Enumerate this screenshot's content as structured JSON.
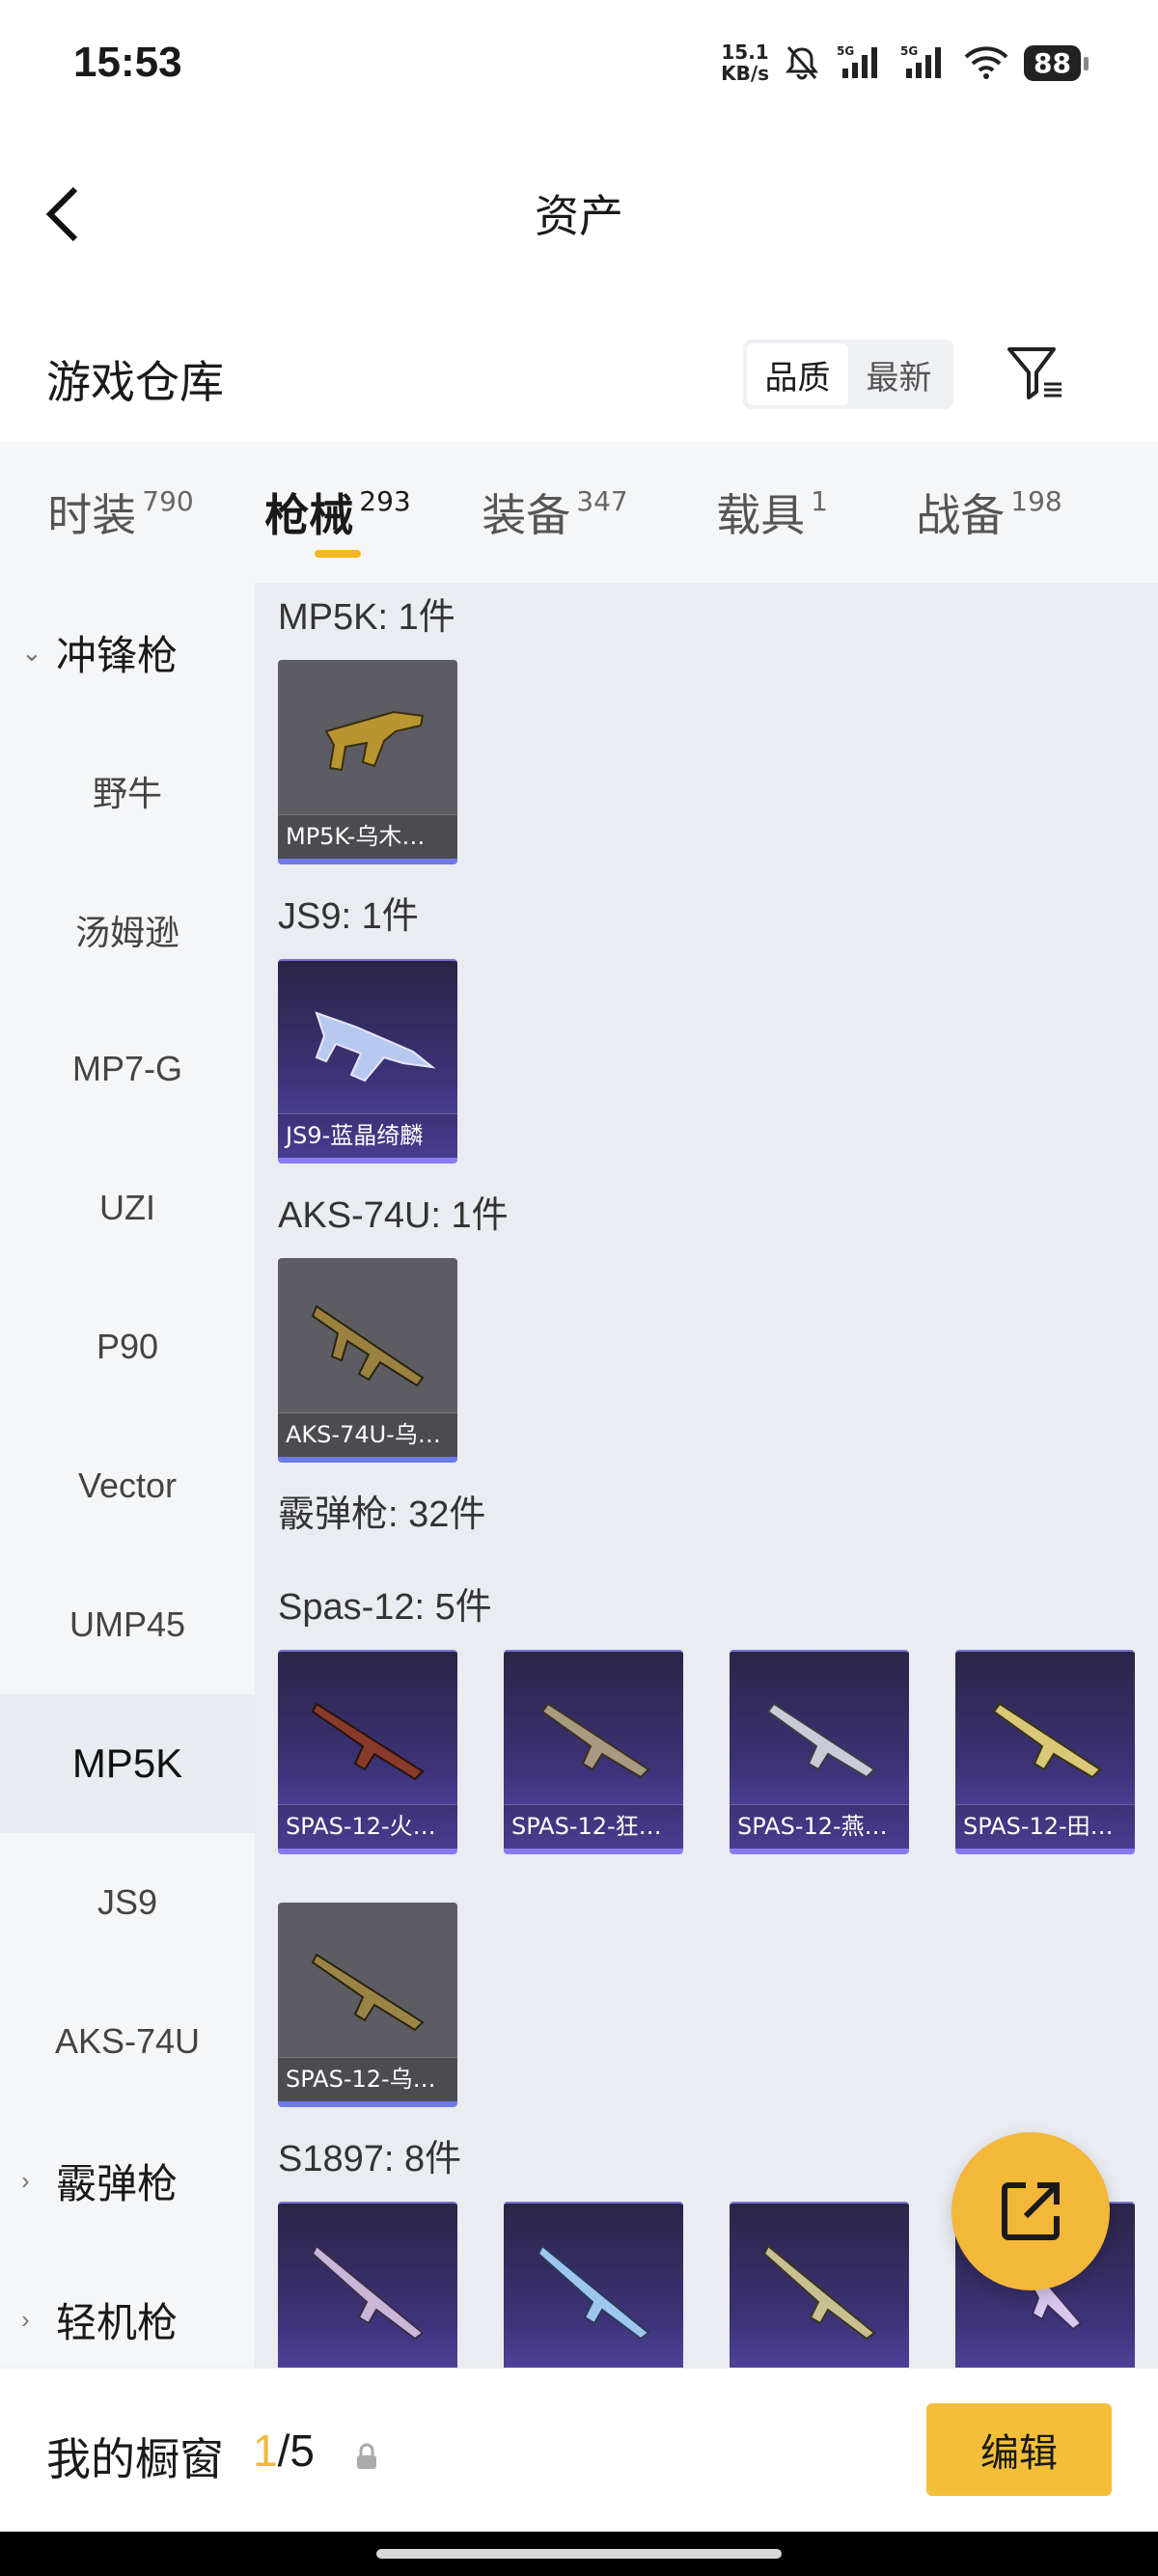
{
  "status": {
    "time": "15:53",
    "net_speed_value": "15.1",
    "net_speed_unit": "KB/s",
    "signal1": "5G",
    "signal2": "5G",
    "battery": "88"
  },
  "header": {
    "title": "资产",
    "back_icon": "chevron-left-icon"
  },
  "warehouse": {
    "title": "游戏仓库",
    "sort": {
      "quality": "品质",
      "latest": "最新",
      "selected": "品质"
    },
    "filter_icon": "filter-icon"
  },
  "tabs": [
    {
      "label": "时装",
      "count": "790"
    },
    {
      "label": "枪械",
      "count": "293",
      "active": true
    },
    {
      "label": "装备",
      "count": "347"
    },
    {
      "label": "载具",
      "count": "1"
    },
    {
      "label": "战备",
      "count": "198"
    }
  ],
  "sidebar": {
    "group_smg": "冲锋枪",
    "items": [
      "野牛",
      "汤姆逊",
      "MP7-G",
      "UZI",
      "P90",
      "Vector",
      "UMP45",
      "MP5K",
      "JS9",
      "AKS-74U"
    ],
    "active": "MP5K",
    "group_shotgun": "霰弹枪",
    "group_lmg": "轻机枪"
  },
  "content": {
    "mp5k_label": "MP5K: 1件",
    "mp5k_card": "MP5K-乌木…",
    "js9_label": "JS9: 1件",
    "js9_card": "JS9-蓝晶绮麟",
    "aks_label": "AKS-74U: 1件",
    "aks_card": "AKS-74U-乌…",
    "shotgun_label": "霰弹枪: 32件",
    "spas_label": "Spas-12: 5件",
    "spas_cards": [
      "SPAS-12-火…",
      "SPAS-12-狂…",
      "SPAS-12-燕…",
      "SPAS-12-田…",
      "SPAS-12-乌…"
    ],
    "s1897_label": "S1897: 8件"
  },
  "fab_icon": "share-icon",
  "bottom": {
    "window_label": "我的橱窗",
    "current": "1",
    "total": "/5",
    "lock_icon": "lock-icon",
    "edit_label": "编辑"
  },
  "colors": {
    "accent": "#f3b73a",
    "purple_card": "#3d3378",
    "grey_card": "#5c5c62"
  }
}
